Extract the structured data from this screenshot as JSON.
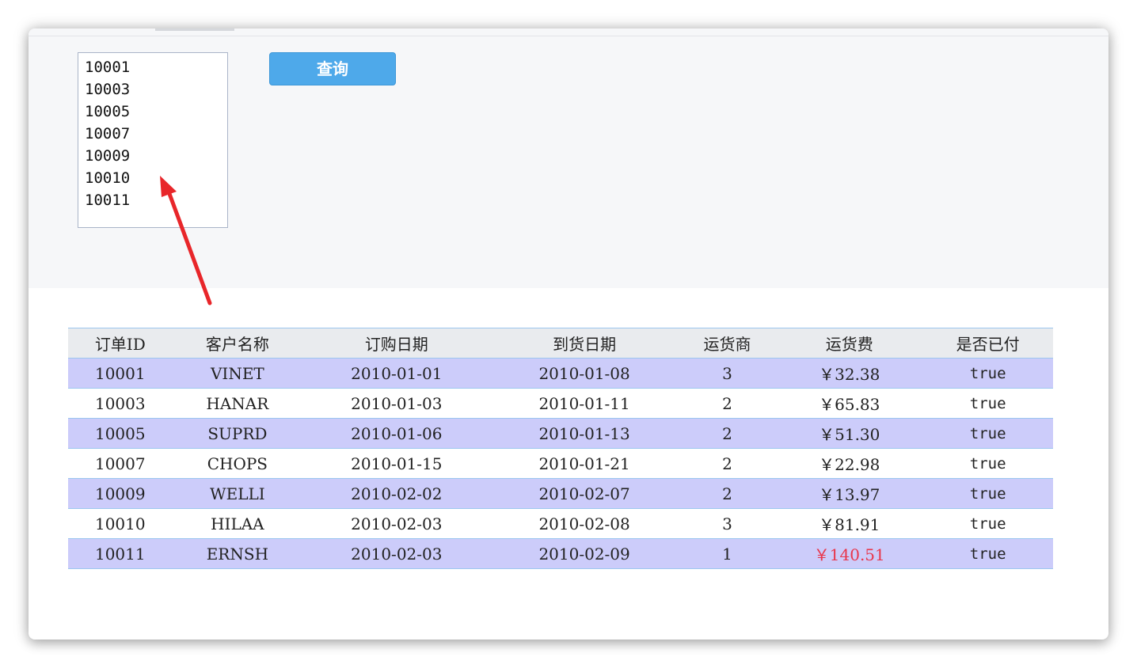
{
  "param_panel": {
    "order_ids": [
      "10001",
      "10003",
      "10005",
      "10007",
      "10009",
      "10010",
      "10011"
    ],
    "query_button_label": "查询"
  },
  "table": {
    "headers": [
      "订单ID",
      "客户名称",
      "订购日期",
      "到货日期",
      "运货商",
      "运货费",
      "是否已付"
    ],
    "rows": [
      [
        "10001",
        "VINET",
        "2010-01-01",
        "2010-01-08",
        "3",
        "￥32.38",
        "true"
      ],
      [
        "10003",
        "HANAR",
        "2010-01-03",
        "2010-01-11",
        "2",
        "￥65.83",
        "true"
      ],
      [
        "10005",
        "SUPRD",
        "2010-01-06",
        "2010-01-13",
        "2",
        "￥51.30",
        "true"
      ],
      [
        "10007",
        "CHOPS",
        "2010-01-15",
        "2010-01-21",
        "2",
        "￥22.98",
        "true"
      ],
      [
        "10009",
        "WELLI",
        "2010-02-02",
        "2010-02-07",
        "2",
        "￥13.97",
        "true"
      ],
      [
        "10010",
        "HILAA",
        "2010-02-03",
        "2010-02-08",
        "3",
        "￥81.91",
        "true"
      ],
      [
        "10011",
        "ERNSH",
        "2010-02-03",
        "2010-02-09",
        "1",
        "￥140.51",
        "true"
      ]
    ],
    "highlight_color": "#e8364b",
    "odd_row_color": "#ccccfa"
  },
  "annotation": {
    "arrow_color": "#e8262a"
  }
}
